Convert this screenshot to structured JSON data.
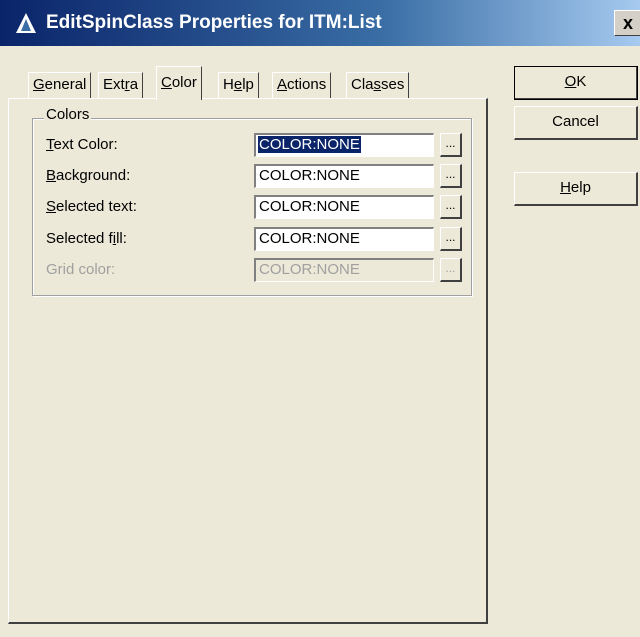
{
  "window": {
    "title": "EditSpinClass Properties for ITM:List",
    "close_label": "x"
  },
  "tabs": [
    {
      "label_pre": "",
      "accel": "G",
      "label_post": "eneral"
    },
    {
      "label_pre": "Ext",
      "accel": "r",
      "label_post": "a"
    },
    {
      "label_pre": "",
      "accel": "C",
      "label_post": "olor"
    },
    {
      "label_pre": "H",
      "accel": "e",
      "label_post": "lp"
    },
    {
      "label_pre": "",
      "accel": "A",
      "label_post": "ctions"
    },
    {
      "label_pre": "Cla",
      "accel": "s",
      "label_post": "ses"
    }
  ],
  "active_tab": "Color",
  "colors_group": {
    "title": "Colors",
    "rows": [
      {
        "label_pre": "",
        "accel": "T",
        "label_post": "ext Color:",
        "value": "COLOR:NONE",
        "button": "...",
        "enabled": true
      },
      {
        "label_pre": "",
        "accel": "B",
        "label_post": "ackground:",
        "value": "COLOR:NONE",
        "button": "...",
        "enabled": true
      },
      {
        "label_pre": "",
        "accel": "S",
        "label_post": "elected text:",
        "value": "COLOR:NONE",
        "button": "...",
        "enabled": true
      },
      {
        "label_pre": "Selected f",
        "accel": "i",
        "label_post": "ll:",
        "value": "COLOR:NONE",
        "button": "...",
        "enabled": true
      },
      {
        "label_pre": "Grid color:",
        "accel": "",
        "label_post": "",
        "value": "COLOR:NONE",
        "button": "...",
        "enabled": false
      }
    ]
  },
  "buttons": {
    "ok": {
      "accel": "O",
      "rest": "K"
    },
    "cancel": "Cancel",
    "help": {
      "accel": "H",
      "rest": "elp"
    }
  },
  "colors": {
    "titlebar_start": "#0a246a",
    "titlebar_end": "#a6caf0",
    "selection": "#0a246a",
    "dialog_bg": "#ece9d8",
    "disabled_text": "#a0a0a0"
  }
}
